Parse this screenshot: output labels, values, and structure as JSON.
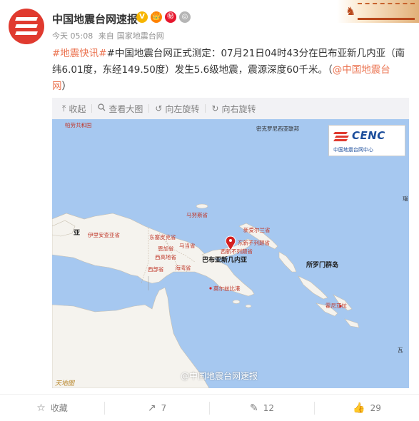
{
  "header": {
    "account_name": "中国地震台网速报",
    "time": "今天 05:08",
    "source_prefix": "来自",
    "source": "国家地震台网",
    "badges": [
      "V",
      "👑",
      "㊙",
      "◎"
    ]
  },
  "post": {
    "tag1": "#地震快讯#",
    "tag2": "#中国地震台网正式测定：",
    "text": "07月21日04时43分在巴布亚新几内亚（南纬6.01度，东经149.50度）发生5.6级地震，震源深度60千米。（",
    "mention": "@中国地震台网",
    "close": "）"
  },
  "toolbar": {
    "collapse": "收起",
    "view_large": "查看大图",
    "rotate_left": "向左旋转",
    "rotate_right": "向右旋转"
  },
  "map": {
    "cenc_logo": "CENC",
    "cenc_sub": "中国地震台网中心",
    "watermark": "@中国地震台网速报",
    "signature": "天地图",
    "labels": {
      "palau": "帕劳共和国",
      "micronesia": "密克罗尼西亚联邦",
      "png": "巴布亚新几内亚",
      "solomon": "所罗门群岛",
      "irian": "伊里安查亚省",
      "sepik": "东塞皮克省",
      "madang": "马当省",
      "wahgi": "西高地省",
      "enga": "恩加省",
      "gulf": "海湾省",
      "western": "西部省",
      "manus": "马努斯省",
      "newireland": "新爱尔兰省",
      "eastnb": "东新不列颠省",
      "westnb": "西新不列颠省",
      "morobe": "莫尔兹比港",
      "honiara": "霍尼亚拉",
      "ya": "亚",
      "bi": "瑙",
      "fei": "瓦"
    }
  },
  "actions": {
    "favorite": "收藏",
    "repost": "7",
    "comment": "12",
    "like": "29"
  },
  "colors": {
    "accent": "#eb7350",
    "sea": "#a6c8f0",
    "land": "#f5f3ee",
    "epicenter": "#d42020"
  }
}
